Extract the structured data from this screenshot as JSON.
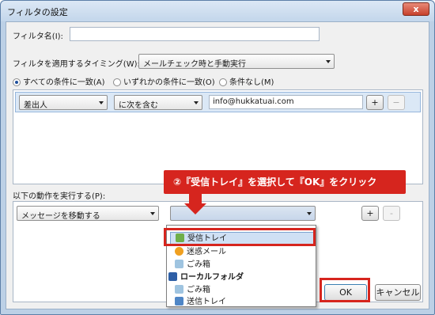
{
  "window": {
    "title": "フィルタの設定",
    "close_glyph": "x"
  },
  "filter_name": {
    "label": "フィルタ名(I):",
    "value": ""
  },
  "timing": {
    "label": "フィルタを適用するタイミング(W):",
    "selected": "メールチェック時と手動実行"
  },
  "match_mode": {
    "options": [
      "すべての条件に一致(A)",
      "いずれかの条件に一致(O)",
      "条件なし(M)"
    ],
    "selected_index": 0
  },
  "condition": {
    "field": "差出人",
    "operator": "に次を含む",
    "value": "info@hukkatuai.com",
    "add_label": "+",
    "remove_label": "−"
  },
  "actions": {
    "label": "以下の動作を実行する(P):",
    "action": "メッセージを移動する",
    "target": "",
    "add_label": "+",
    "remove_label": "-"
  },
  "folder_dropdown": {
    "items": [
      {
        "label": "受信トレイ",
        "icon": "inbox-icon",
        "selected": true,
        "bold": false
      },
      {
        "label": "迷惑メール",
        "icon": "junk-icon",
        "selected": false,
        "bold": false
      },
      {
        "label": "ごみ箱",
        "icon": "trash-icon",
        "selected": false,
        "bold": false
      },
      {
        "label": "ローカルフォルダ",
        "icon": "local-folder-icon",
        "selected": false,
        "bold": true
      },
      {
        "label": "ごみ箱",
        "icon": "trash-icon",
        "selected": false,
        "bold": false
      },
      {
        "label": "送信トレイ",
        "icon": "outbox-icon",
        "selected": false,
        "bold": false
      }
    ]
  },
  "buttons": {
    "ok": "OK",
    "cancel": "キャンセル"
  },
  "callout": {
    "text": "②『受信トレイ』を選択して『OK』をクリック"
  },
  "colors": {
    "highlight": "#d6251e",
    "selection": "#dbe8f6",
    "accent": "#1f4f9c"
  }
}
